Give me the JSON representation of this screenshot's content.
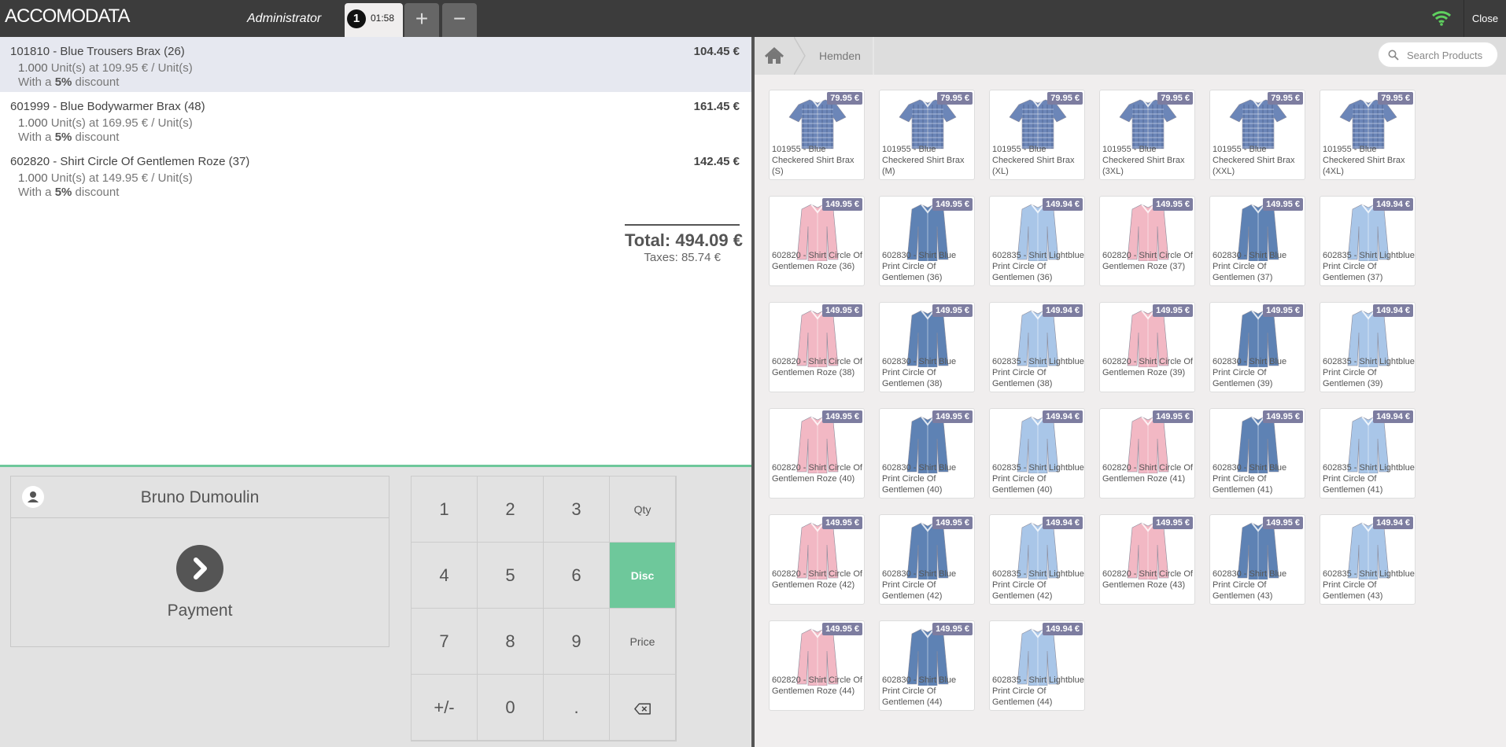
{
  "app": {
    "logo_text": "ACCOMODATA",
    "username": "Administrator",
    "order_tab": {
      "number": "1",
      "time": "01:58"
    },
    "add_order_label": "+",
    "remove_order_label": "−",
    "close_label": "Close"
  },
  "order": {
    "lines": [
      {
        "name": "101810 - Blue Trousers Brax (26)",
        "price": "104.45 €",
        "qty": "1.000",
        "unit_info": "Unit(s) at 109.95 € / Unit(s)",
        "disc_prefix": "With a ",
        "disc_value": "5%",
        "disc_suffix": " discount",
        "selected": true
      },
      {
        "name": "601999 - Blue Bodywarmer Brax (48)",
        "price": "161.45 €",
        "qty": "1.000",
        "unit_info": "Unit(s) at 169.95 € / Unit(s)",
        "disc_prefix": "With a ",
        "disc_value": "5%",
        "disc_suffix": " discount",
        "selected": false
      },
      {
        "name": "602820 - Shirt Circle Of Gentlemen Roze (37)",
        "price": "142.45 €",
        "qty": "1.000",
        "unit_info": "Unit(s) at 149.95 € / Unit(s)",
        "disc_prefix": "With a ",
        "disc_value": "5%",
        "disc_suffix": " discount",
        "selected": false
      }
    ],
    "total": "Total: 494.09 €",
    "taxes": "Taxes: 85.74 €"
  },
  "customer": {
    "name": "Bruno Dumoulin"
  },
  "payment_label": "Payment",
  "numpad": {
    "keys": [
      "1",
      "2",
      "3",
      "Qty",
      "4",
      "5",
      "6",
      "Disc",
      "7",
      "8",
      "9",
      "Price",
      "+/-",
      "0",
      ".",
      "⌫"
    ],
    "active_mode": "Disc"
  },
  "products_header": {
    "breadcrumb": "Hemden",
    "search_placeholder": "Search Products"
  },
  "products": [
    {
      "name": "101955 - Blue Checkered Shirt Brax (S)",
      "price": "79.95 €",
      "kind": "check"
    },
    {
      "name": "101955 - Blue Checkered Shirt Brax (M)",
      "price": "79.95 €",
      "kind": "check"
    },
    {
      "name": "101955 - Blue Checkered Shirt Brax (XL)",
      "price": "79.95 €",
      "kind": "check"
    },
    {
      "name": "101955 - Blue Checkered Shirt Brax (3XL)",
      "price": "79.95 €",
      "kind": "check"
    },
    {
      "name": "101955 - Blue Checkered Shirt Brax (XXL)",
      "price": "79.95 €",
      "kind": "check"
    },
    {
      "name": "101955 - Blue Checkered Shirt Brax (4XL)",
      "price": "79.95 €",
      "kind": "check"
    },
    {
      "name": "602820 - Shirt Circle Of Gentlemen Roze (36)",
      "price": "149.95 €",
      "kind": "pink"
    },
    {
      "name": "602830 - Shirt Blue Print Circle Of Gentlemen (36)",
      "price": "149.95 €",
      "kind": "blue"
    },
    {
      "name": "602835 - Shirt Lightblue Print Circle Of Gentlemen (36)",
      "price": "149.94 €",
      "kind": "light"
    },
    {
      "name": "602820 - Shirt Circle Of Gentlemen Roze (37)",
      "price": "149.95 €",
      "kind": "pink"
    },
    {
      "name": "602830 - Shirt Blue Print Circle Of Gentlemen (37)",
      "price": "149.95 €",
      "kind": "blue"
    },
    {
      "name": "602835 - Shirt Lightblue Print Circle Of Gentlemen (37)",
      "price": "149.94 €",
      "kind": "light"
    },
    {
      "name": "602820 - Shirt Circle Of Gentlemen Roze (38)",
      "price": "149.95 €",
      "kind": "pink"
    },
    {
      "name": "602830 - Shirt Blue Print Circle Of Gentlemen (38)",
      "price": "149.95 €",
      "kind": "blue"
    },
    {
      "name": "602835 - Shirt Lightblue Print Circle Of Gentlemen (38)",
      "price": "149.94 €",
      "kind": "light"
    },
    {
      "name": "602820 - Shirt Circle Of Gentlemen Roze (39)",
      "price": "149.95 €",
      "kind": "pink"
    },
    {
      "name": "602830 - Shirt Blue Print Circle Of Gentlemen (39)",
      "price": "149.95 €",
      "kind": "blue"
    },
    {
      "name": "602835 - Shirt Lightblue Print Circle Of Gentlemen (39)",
      "price": "149.94 €",
      "kind": "light"
    },
    {
      "name": "602820 - Shirt Circle Of Gentlemen Roze (40)",
      "price": "149.95 €",
      "kind": "pink"
    },
    {
      "name": "602830 - Shirt Blue Print Circle Of Gentlemen (40)",
      "price": "149.95 €",
      "kind": "blue"
    },
    {
      "name": "602835 - Shirt Lightblue Print Circle Of Gentlemen (40)",
      "price": "149.94 €",
      "kind": "light"
    },
    {
      "name": "602820 - Shirt Circle Of Gentlemen Roze (41)",
      "price": "149.95 €",
      "kind": "pink"
    },
    {
      "name": "602830 - Shirt Blue Print Circle Of Gentlemen (41)",
      "price": "149.95 €",
      "kind": "blue"
    },
    {
      "name": "602835 - Shirt Lightblue Print Circle Of Gentlemen (41)",
      "price": "149.94 €",
      "kind": "light"
    },
    {
      "name": "602820 - Shirt Circle Of Gentlemen Roze (42)",
      "price": "149.95 €",
      "kind": "pink"
    },
    {
      "name": "602830 - Shirt Blue Print Circle Of Gentlemen (42)",
      "price": "149.95 €",
      "kind": "blue"
    },
    {
      "name": "602835 - Shirt Lightblue Print Circle Of Gentlemen (42)",
      "price": "149.94 €",
      "kind": "light"
    },
    {
      "name": "602820 - Shirt Circle Of Gentlemen Roze (43)",
      "price": "149.95 €",
      "kind": "pink"
    },
    {
      "name": "602830 - Shirt Blue Print Circle Of Gentlemen (43)",
      "price": "149.95 €",
      "kind": "blue"
    },
    {
      "name": "602835 - Shirt Lightblue Print Circle Of Gentlemen (43)",
      "price": "149.94 €",
      "kind": "light"
    },
    {
      "name": "602820 - Shirt Circle Of Gentlemen Roze (44)",
      "price": "149.95 €",
      "kind": "pink"
    },
    {
      "name": "602830 - Shirt Blue Print Circle Of Gentlemen (44)",
      "price": "149.95 €",
      "kind": "blue"
    },
    {
      "name": "602835 - Shirt Lightblue Print Circle Of Gentlemen (44)",
      "price": "149.94 €",
      "kind": "light"
    }
  ],
  "colors": {
    "topbar": "#3c3c3c",
    "accent_green": "#6ec89b",
    "price_badge": "#7d7da0",
    "selected_line": "#e6e8f0",
    "wifi": "#5fd05f",
    "shirt_pink": "#f2b8c4",
    "shirt_blue": "#5e82b4",
    "shirt_light": "#a9c6e8",
    "shirt_check": "#6c86b8"
  },
  "icons": {
    "home": "home-icon",
    "search": "search-icon",
    "wifi": "wifi-icon",
    "customer": "user-icon",
    "payment": "chevron-right-icon",
    "backspace": "backspace-icon"
  }
}
